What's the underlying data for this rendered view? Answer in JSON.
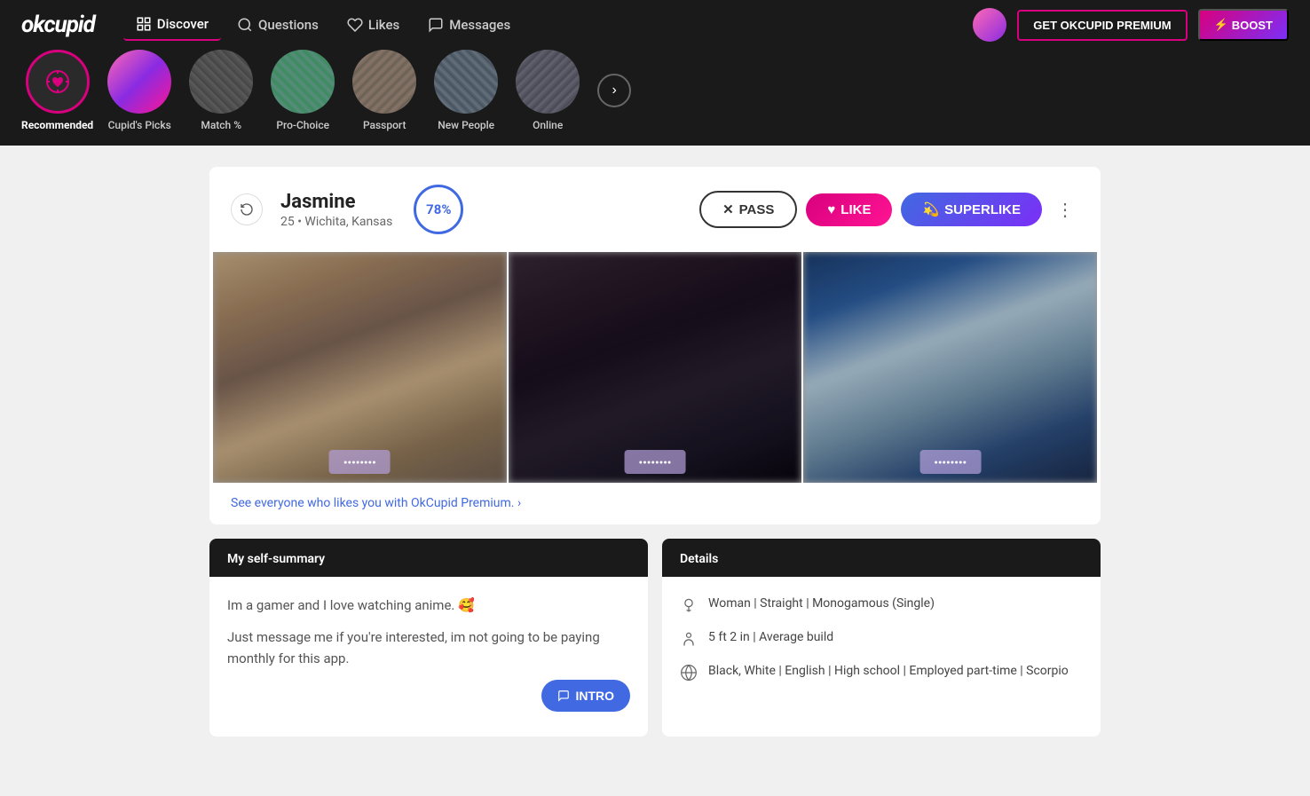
{
  "logo": "okcupid",
  "nav": {
    "items": [
      {
        "id": "discover",
        "label": "Discover",
        "active": true
      },
      {
        "id": "questions",
        "label": "Questions",
        "active": false
      },
      {
        "id": "likes",
        "label": "Likes",
        "active": false
      },
      {
        "id": "messages",
        "label": "Messages",
        "active": false
      }
    ]
  },
  "header_buttons": {
    "premium": "GET OKCUPID PREMIUM",
    "boost": "BOOST"
  },
  "categories": [
    {
      "id": "recommended",
      "label": "Recommended",
      "active": true,
      "type": "icon"
    },
    {
      "id": "cupids-picks",
      "label": "Cupid's Picks",
      "active": false,
      "type": "pixelated"
    },
    {
      "id": "match",
      "label": "Match %",
      "active": false,
      "type": "pixelated"
    },
    {
      "id": "pro-choice",
      "label": "Pro-Choice",
      "active": false,
      "type": "pixelated"
    },
    {
      "id": "passport",
      "label": "Passport",
      "active": false,
      "type": "pixelated"
    },
    {
      "id": "new-people",
      "label": "New People",
      "active": false,
      "type": "pixelated"
    },
    {
      "id": "online",
      "label": "Online",
      "active": false,
      "type": "pixelated"
    }
  ],
  "profile": {
    "name": "Jasmine",
    "age": "25",
    "location": "Wichita, Kansas",
    "match_percent": "78%",
    "buttons": {
      "pass": "PASS",
      "like": "LIKE",
      "superlike": "SUPERLIKE"
    },
    "premium_prompt": "See everyone who likes you with OkCupid Premium. ›",
    "self_summary": {
      "header": "My self-summary",
      "text1": "Im a gamer and I love watching anime. 🥰",
      "text2": "Just message me if you're interested, im not going to be paying monthly for this app.",
      "intro_btn": "INTRO"
    },
    "details": {
      "header": "Details",
      "rows": [
        {
          "icon": "gender",
          "text": "Woman | Straight | Monogamous (Single)"
        },
        {
          "icon": "height",
          "text": "5 ft 2 in | Average build"
        },
        {
          "icon": "ethnicity",
          "text": "Black, White | English | High school | Employed part-time | Scorpio"
        }
      ]
    }
  }
}
